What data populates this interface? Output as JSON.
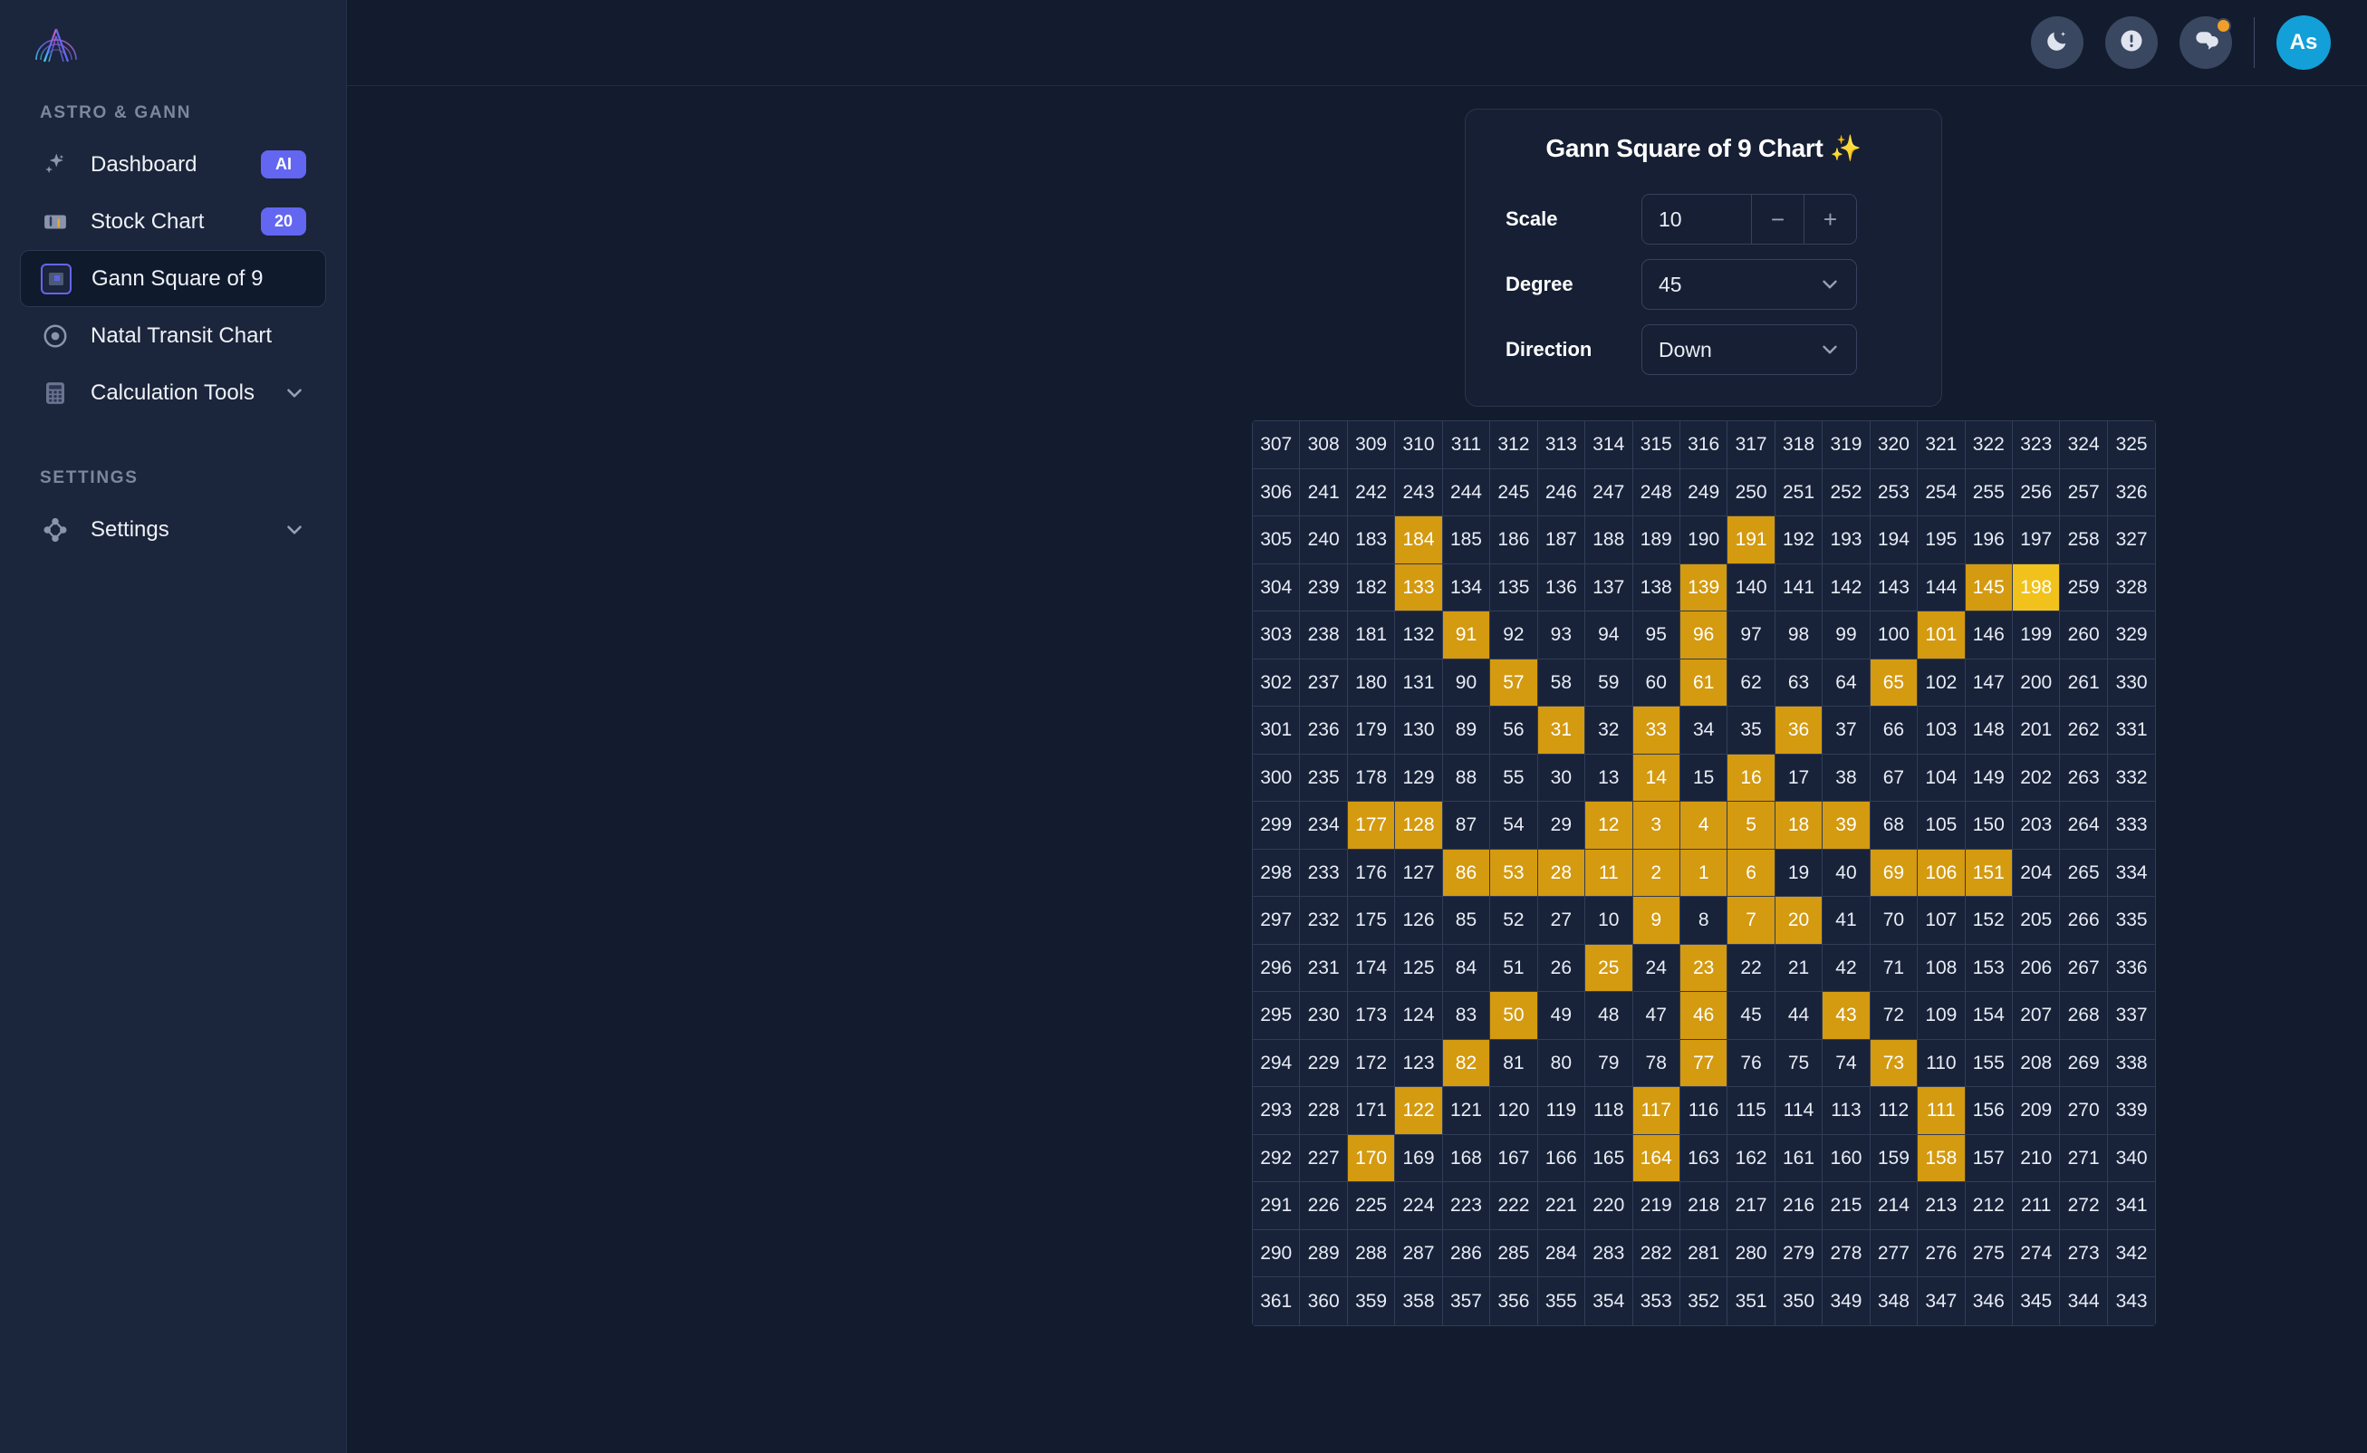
{
  "sidebar": {
    "logo_name": "astro-gann-logo",
    "sections": [
      {
        "label": "ASTRO & GANN",
        "items": [
          {
            "label": "Dashboard",
            "icon": "sparkles-icon",
            "badge": "AI",
            "active": false,
            "chevron": false
          },
          {
            "label": "Stock Chart",
            "icon": "candlestick-icon",
            "badge": "20",
            "active": false,
            "chevron": false
          },
          {
            "label": "Gann Square of 9",
            "icon": "gann-square-icon",
            "badge": null,
            "active": true,
            "chevron": false
          },
          {
            "label": "Natal Transit Chart",
            "icon": "target-icon",
            "badge": null,
            "active": false,
            "chevron": false
          },
          {
            "label": "Calculation Tools",
            "icon": "calculator-icon",
            "badge": null,
            "active": false,
            "chevron": true
          }
        ]
      },
      {
        "label": "SETTINGS",
        "items": [
          {
            "label": "Settings",
            "icon": "nodes-icon",
            "badge": null,
            "active": false,
            "chevron": true
          }
        ]
      }
    ]
  },
  "topbar": {
    "buttons": [
      {
        "name": "dark-mode-toggle",
        "icon": "moon-icon",
        "dot": false
      },
      {
        "name": "alerts-button",
        "icon": "alert-circle-icon",
        "dot": false
      },
      {
        "name": "messages-button",
        "icon": "chat-bubble-icon",
        "dot": true
      }
    ],
    "avatar_initials": "As",
    "avatar_color": "#13a0d8"
  },
  "panel": {
    "title": "Gann Square of 9 Chart ✨",
    "scale": {
      "label": "Scale",
      "value": "10",
      "minus": "−",
      "plus": "+"
    },
    "degree": {
      "label": "Degree",
      "value": "45"
    },
    "direction": {
      "label": "Direction",
      "value": "Down"
    }
  },
  "colors": {
    "highlight": "#d49a10",
    "highlight_bright": "#f2c21c",
    "cell_bg": "#18233a",
    "badge": "#6366f1",
    "accent": "#6366f1"
  },
  "chart_data": {
    "type": "table",
    "title": "Gann Square of 9 Chart",
    "rows": 19,
    "cols": 19,
    "scale": 10,
    "degree": 45,
    "direction": "Down",
    "grid": [
      [
        307,
        308,
        309,
        310,
        311,
        312,
        313,
        314,
        315,
        316,
        317,
        318,
        319,
        320,
        321,
        322,
        323,
        324,
        325
      ],
      [
        306,
        241,
        242,
        243,
        244,
        245,
        246,
        247,
        248,
        249,
        250,
        251,
        252,
        253,
        254,
        255,
        256,
        257,
        326
      ],
      [
        305,
        240,
        183,
        184,
        185,
        186,
        187,
        188,
        189,
        190,
        191,
        192,
        193,
        194,
        195,
        196,
        197,
        258,
        327
      ],
      [
        304,
        239,
        182,
        133,
        134,
        135,
        136,
        137,
        138,
        139,
        140,
        141,
        142,
        143,
        144,
        145,
        198,
        259,
        328
      ],
      [
        303,
        238,
        181,
        132,
        91,
        92,
        93,
        94,
        95,
        96,
        97,
        98,
        99,
        100,
        101,
        146,
        199,
        260,
        329
      ],
      [
        302,
        237,
        180,
        131,
        90,
        57,
        58,
        59,
        60,
        61,
        62,
        63,
        64,
        65,
        102,
        147,
        200,
        261,
        330
      ],
      [
        301,
        236,
        179,
        130,
        89,
        56,
        31,
        32,
        33,
        34,
        35,
        36,
        37,
        66,
        103,
        148,
        201,
        262,
        331
      ],
      [
        300,
        235,
        178,
        129,
        88,
        55,
        30,
        13,
        14,
        15,
        16,
        17,
        38,
        67,
        104,
        149,
        202,
        263,
        332
      ],
      [
        299,
        234,
        177,
        128,
        87,
        54,
        29,
        12,
        3,
        4,
        5,
        18,
        39,
        68,
        105,
        150,
        203,
        264,
        333
      ],
      [
        298,
        233,
        176,
        127,
        86,
        53,
        28,
        11,
        2,
        1,
        6,
        19,
        40,
        69,
        106,
        151,
        204,
        265,
        334
      ],
      [
        297,
        232,
        175,
        126,
        85,
        52,
        27,
        10,
        9,
        8,
        7,
        20,
        41,
        70,
        107,
        152,
        205,
        266,
        335
      ],
      [
        296,
        231,
        174,
        125,
        84,
        51,
        26,
        25,
        24,
        23,
        22,
        21,
        42,
        71,
        108,
        153,
        206,
        267,
        336
      ],
      [
        295,
        230,
        173,
        124,
        83,
        50,
        49,
        48,
        47,
        46,
        45,
        44,
        43,
        72,
        109,
        154,
        207,
        268,
        337
      ],
      [
        294,
        229,
        172,
        123,
        82,
        81,
        80,
        79,
        78,
        77,
        76,
        75,
        74,
        73,
        110,
        155,
        208,
        269,
        338
      ],
      [
        293,
        228,
        171,
        122,
        121,
        120,
        119,
        118,
        117,
        116,
        115,
        114,
        113,
        112,
        111,
        156,
        209,
        270,
        339
      ],
      [
        292,
        227,
        170,
        169,
        168,
        167,
        166,
        165,
        164,
        163,
        162,
        161,
        160,
        159,
        158,
        157,
        210,
        271,
        340
      ],
      [
        291,
        226,
        225,
        224,
        223,
        222,
        221,
        220,
        219,
        218,
        217,
        216,
        215,
        214,
        213,
        212,
        211,
        272,
        341
      ],
      [
        290,
        289,
        288,
        287,
        286,
        285,
        284,
        283,
        282,
        281,
        280,
        279,
        278,
        277,
        276,
        275,
        274,
        273,
        342
      ],
      [
        361,
        360,
        359,
        358,
        357,
        356,
        355,
        354,
        353,
        352,
        351,
        350,
        349,
        348,
        347,
        346,
        345,
        344,
        343
      ]
    ],
    "highlighted": [
      184,
      133,
      191,
      139,
      145,
      91,
      96,
      101,
      57,
      61,
      65,
      31,
      33,
      36,
      14,
      16,
      177,
      128,
      12,
      3,
      4,
      5,
      18,
      39,
      86,
      53,
      28,
      11,
      2,
      1,
      6,
      69,
      106,
      151,
      9,
      7,
      20,
      25,
      23,
      50,
      46,
      43,
      82,
      77,
      73,
      122,
      117,
      111,
      170,
      164,
      158
    ],
    "highlight_special": [
      198
    ]
  }
}
